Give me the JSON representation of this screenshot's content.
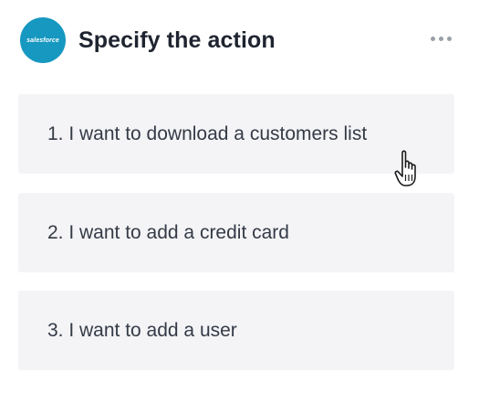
{
  "header": {
    "logo_text": "salesforce",
    "title": "Specify the action",
    "more_icon": "more-horizontal-icon"
  },
  "options": [
    {
      "label": "1. I want to download a customers list"
    },
    {
      "label": "2. I want to add a credit card"
    },
    {
      "label": "3. I want to add a user"
    }
  ],
  "colors": {
    "logo_bg": "#1798c1",
    "option_bg": "#f4f4f6",
    "title": "#1f2430",
    "option_text": "#343a46"
  },
  "cursor": {
    "icon": "hand-pointer-icon"
  }
}
